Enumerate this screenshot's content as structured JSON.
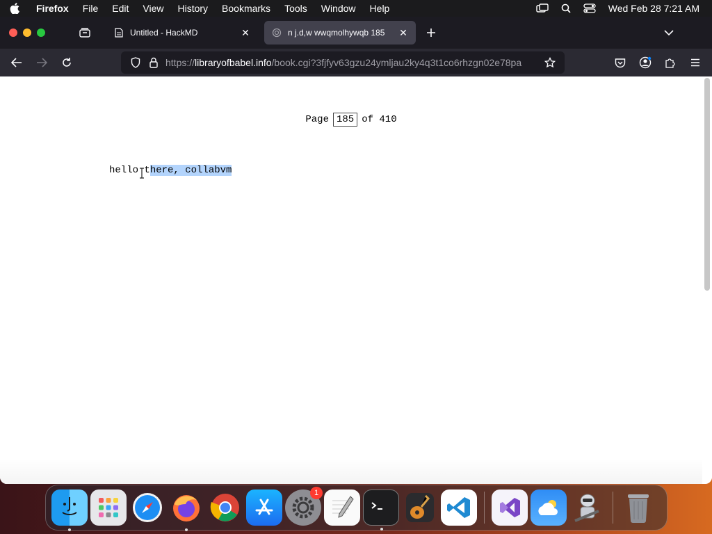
{
  "menubar": {
    "app_name": "Firefox",
    "items": [
      "File",
      "Edit",
      "View",
      "History",
      "Bookmarks",
      "Tools",
      "Window",
      "Help"
    ],
    "clock": "Wed Feb 28  7:21 AM"
  },
  "tabs": [
    {
      "title": "Untitled - HackMD",
      "active": false
    },
    {
      "title": "n j.d,w wwqmolhywqb 185",
      "active": true
    }
  ],
  "urlbar": {
    "prefix": "https://",
    "host": "libraryofbabel.info",
    "path": "/book.cgi?3fjfyv63gzu24ymljau2ky4q3t1co6rhzgn02e78pa"
  },
  "page": {
    "label_page": "Page",
    "current_page": "185",
    "label_of": "of",
    "total_pages": "410",
    "text_plain": "hello t",
    "text_selected": "here, collabvm"
  },
  "dock": {
    "apps": [
      "Finder",
      "Launchpad",
      "Safari",
      "Firefox",
      "Chrome",
      "App Store",
      "System Settings",
      "TextEdit",
      "Terminal",
      "GarageBand",
      "Visual Studio Code",
      "Visual Studio",
      "Weather",
      "Automator",
      "Trash"
    ],
    "system_settings_badge": "1"
  },
  "colors": {
    "selection": "#b3d4fc",
    "tab_active": "#42414d",
    "toolbar": "#2b2a33"
  }
}
